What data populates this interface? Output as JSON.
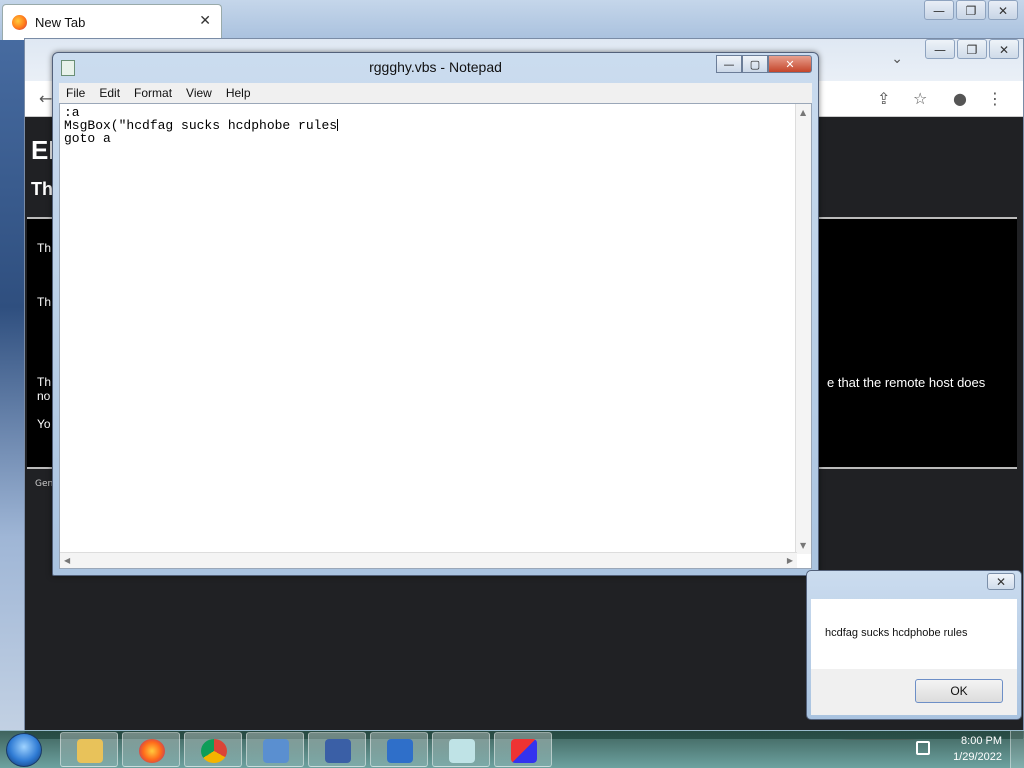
{
  "firefox": {
    "tab_title": "New Tab",
    "tab_close": "✕",
    "minimize": "—",
    "restore": "❐",
    "close": "✕"
  },
  "chrome": {
    "minimize": "—",
    "restore": "❐",
    "close": "✕",
    "chevron": "⌄",
    "big_heading": "EI",
    "sub_heading": "Th",
    "lines": [
      "Th",
      "Th",
      "Th",
      "no",
      "Yo"
    ],
    "remote_host_text": "e that the remote host does",
    "footer": "Gen",
    "back": "←",
    "reload": "⟳",
    "share": "⇪",
    "star": "☆",
    "profile": "●",
    "menu": "⋮"
  },
  "notepad": {
    "title": "rggghy.vbs - Notepad",
    "menu": [
      "File",
      "Edit",
      "Format",
      "View",
      "Help"
    ],
    "lines": [
      ":a",
      "MsgBox(\"hcdfag sucks hcdphobe rules",
      "goto a"
    ],
    "minimize": "—",
    "maximize": "▢",
    "close": "✕"
  },
  "msgbox": {
    "message": "hcdfag sucks hcdphobe rules",
    "ok_label": "OK",
    "close": "✕"
  },
  "taskbar": {
    "time": "8:00 PM",
    "date": "1/29/2022",
    "items": [
      "explorer-icon",
      "firefox-icon",
      "chrome-icon",
      "control-panel-icon",
      "vbs-editor-icon",
      "remote-desktop-icon",
      "notepad-icon",
      "package-icon"
    ]
  }
}
